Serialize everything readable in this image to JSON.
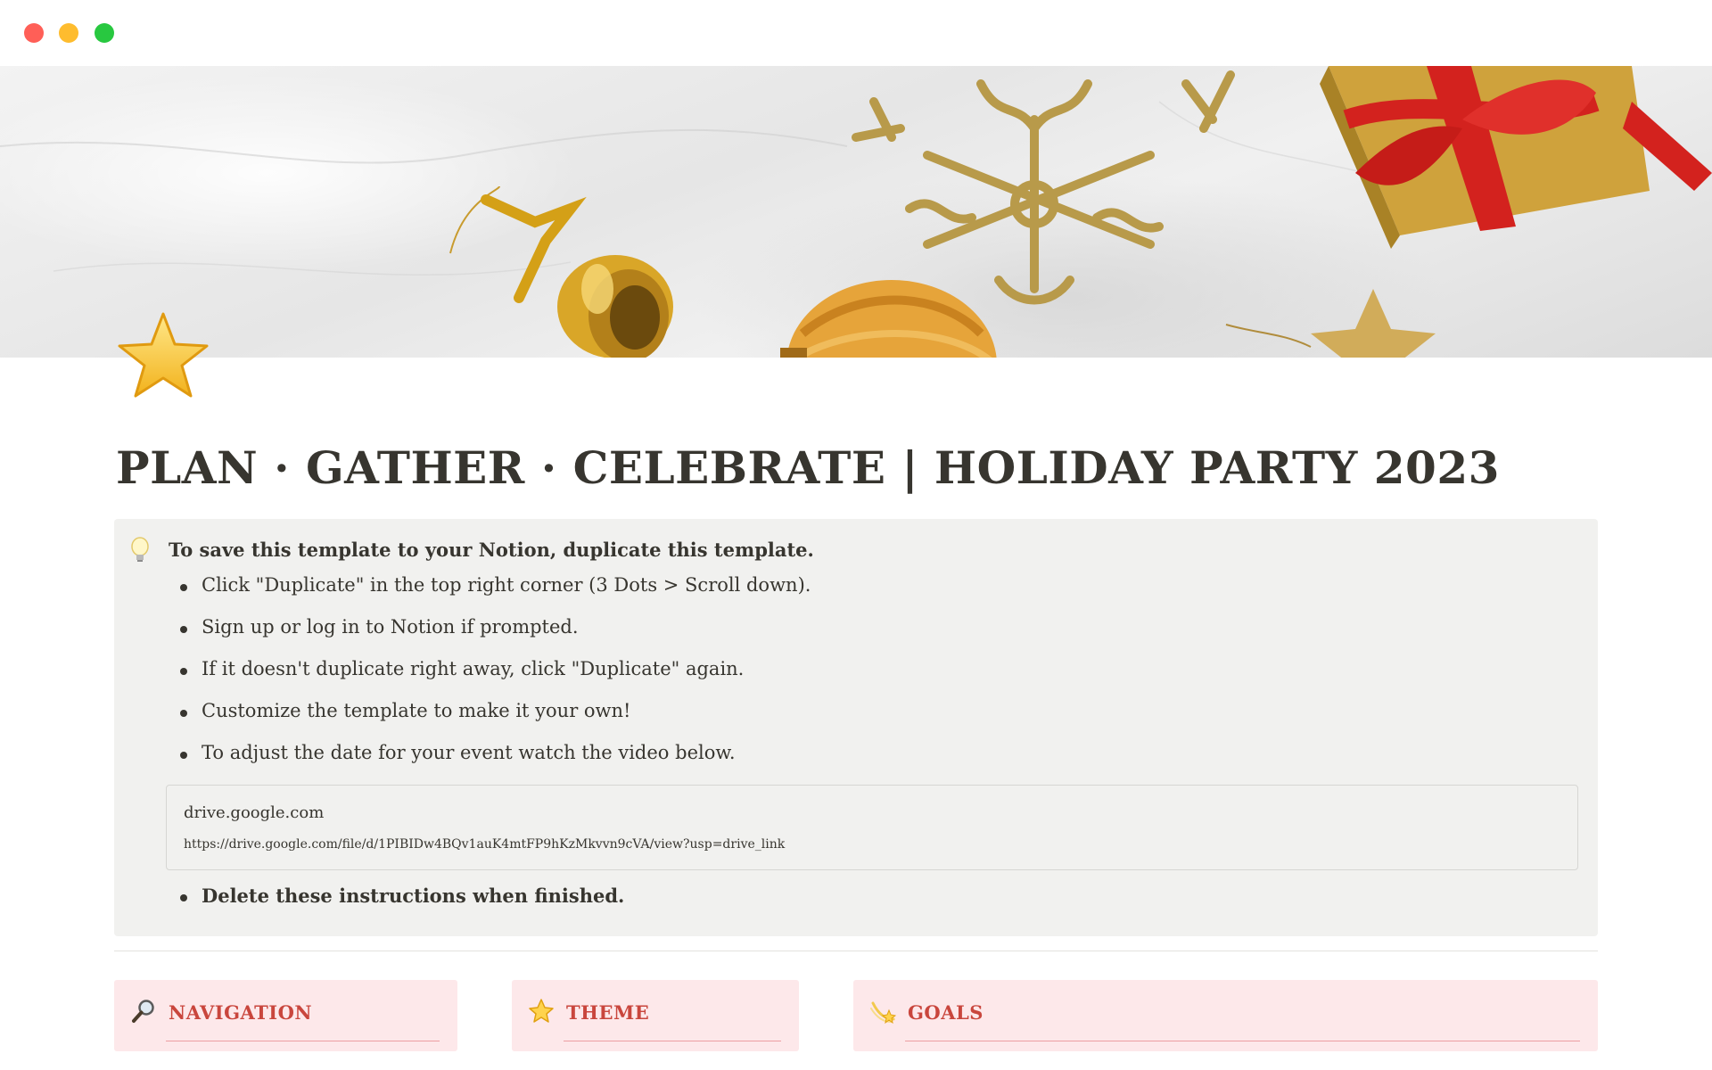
{
  "window": {
    "controls": [
      "close",
      "minimize",
      "maximize"
    ]
  },
  "cover": {
    "decorations": [
      "bell-ornament",
      "glitter-snowflake",
      "gift-box-with-red-ribbon",
      "gold-ball-ornament",
      "glitter-star"
    ]
  },
  "page": {
    "icon": "star-icon",
    "title": "PLAN · GATHER · CELEBRATE | HOLIDAY PARTY 2023"
  },
  "callout": {
    "icon": "lightbulb-icon",
    "heading": "To save this template to your Notion, duplicate this template.",
    "bullets": [
      "Click \"Duplicate\" in the top right corner (3 Dots > Scroll down).",
      "Sign up or log in to Notion if prompted.",
      "If it doesn't duplicate right away, click \"Duplicate\" again.",
      "Customize the template to make it your own!",
      "To adjust the date for your event watch the video below."
    ],
    "bookmark": {
      "domain": "drive.google.com",
      "url": "https://drive.google.com/file/d/1PIBIDw4BQv1auK4mtFP9hKzMkvvn9cVA/view?usp=drive_link"
    },
    "final_bullet": "Delete these instructions when finished."
  },
  "sections": [
    {
      "icon": "magnifying-glass-icon",
      "label": "NAVIGATION"
    },
    {
      "icon": "star-icon",
      "label": "THEME"
    },
    {
      "icon": "shooting-star-icon",
      "label": "GOALS"
    }
  ],
  "colors": {
    "section_bg": "#fde8ea",
    "section_label": "#c9463d",
    "callout_bg": "#f1f1ef",
    "text": "#37352f"
  }
}
